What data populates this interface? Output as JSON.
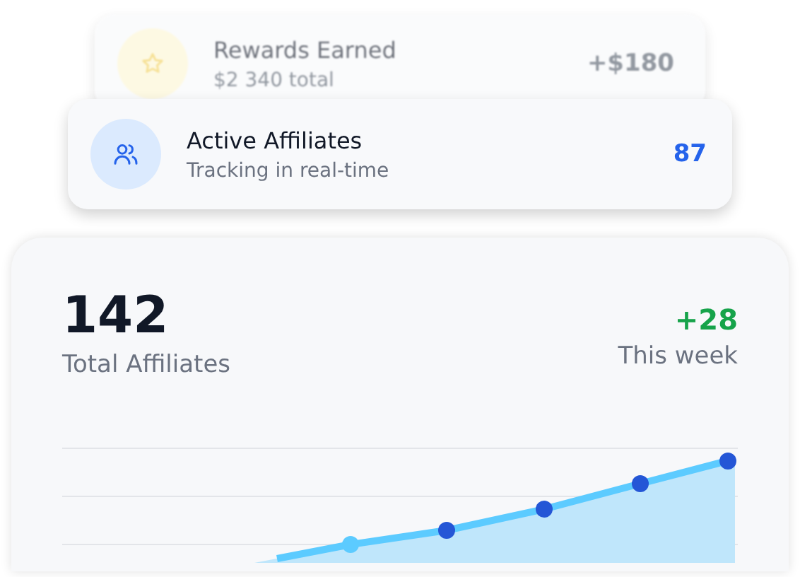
{
  "activity_cards": [
    {
      "kind": "reward",
      "title": "Rewards Earned",
      "subtitle": "$2 340 total",
      "value": "+$180",
      "dimmed": true
    },
    {
      "kind": "affiliates",
      "title": "Active Affiliates",
      "subtitle": "Tracking in real-time",
      "value": "87",
      "dimmed": false
    }
  ],
  "summary": {
    "total": "142",
    "total_label": "Total Affiliates",
    "change": "+28",
    "change_label": "This week"
  }
}
